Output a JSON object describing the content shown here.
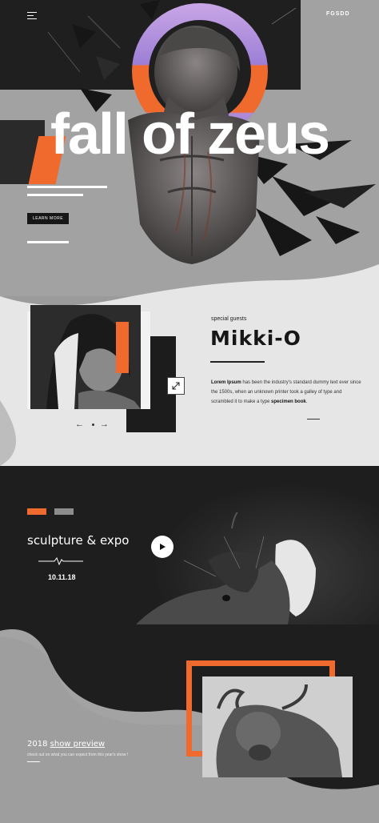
{
  "header": {
    "logo": "FGSDD",
    "menu_icon": "hamburger-menu-icon"
  },
  "hero": {
    "title": "fall of zeus",
    "cta_label": "LEARN MORE"
  },
  "guest": {
    "eyebrow": "special guests",
    "name": "Mikki-O",
    "bio_lead": "Lorem Ipsum",
    "bio_body": " has been the industry's standard dummy text ever since the 1500s, when an unknown printer took a galley of type and scrambled it to make a type ",
    "bio_strong": "specimen book",
    "bio_end": ".",
    "prev_icon": "arrow-left-icon",
    "next_icon": "arrow-right-icon",
    "expand_icon": "expand-icon"
  },
  "expo": {
    "title": "sculpture & expo",
    "date": "10.11.18",
    "play_icon": "play-icon"
  },
  "preview": {
    "title_prefix": "2018",
    "title_link": "show preview",
    "subtitle": "check out on what you can expect from this year's show !"
  },
  "colors": {
    "accent": "#f06a2e",
    "dark": "#1e1e1e",
    "light": "#e6e6e6",
    "mid": "#9b9b9b"
  }
}
